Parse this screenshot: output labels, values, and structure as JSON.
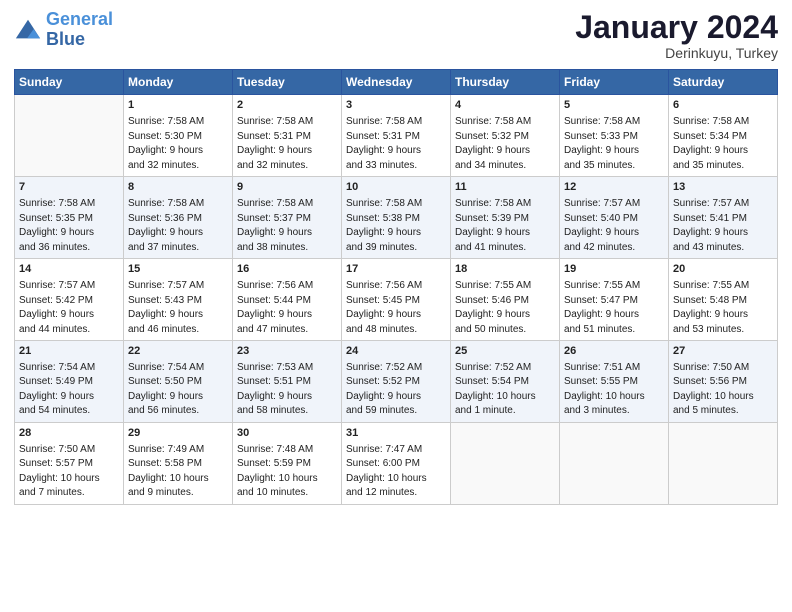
{
  "logo": {
    "line1": "General",
    "line2": "Blue"
  },
  "title": "January 2024",
  "subtitle": "Derinkuyu, Turkey",
  "days_of_week": [
    "Sunday",
    "Monday",
    "Tuesday",
    "Wednesday",
    "Thursday",
    "Friday",
    "Saturday"
  ],
  "weeks": [
    [
      {
        "day": "",
        "content": ""
      },
      {
        "day": "1",
        "content": "Sunrise: 7:58 AM\nSunset: 5:30 PM\nDaylight: 9 hours\nand 32 minutes."
      },
      {
        "day": "2",
        "content": "Sunrise: 7:58 AM\nSunset: 5:31 PM\nDaylight: 9 hours\nand 32 minutes."
      },
      {
        "day": "3",
        "content": "Sunrise: 7:58 AM\nSunset: 5:31 PM\nDaylight: 9 hours\nand 33 minutes."
      },
      {
        "day": "4",
        "content": "Sunrise: 7:58 AM\nSunset: 5:32 PM\nDaylight: 9 hours\nand 34 minutes."
      },
      {
        "day": "5",
        "content": "Sunrise: 7:58 AM\nSunset: 5:33 PM\nDaylight: 9 hours\nand 35 minutes."
      },
      {
        "day": "6",
        "content": "Sunrise: 7:58 AM\nSunset: 5:34 PM\nDaylight: 9 hours\nand 35 minutes."
      }
    ],
    [
      {
        "day": "7",
        "content": "Sunrise: 7:58 AM\nSunset: 5:35 PM\nDaylight: 9 hours\nand 36 minutes."
      },
      {
        "day": "8",
        "content": "Sunrise: 7:58 AM\nSunset: 5:36 PM\nDaylight: 9 hours\nand 37 minutes."
      },
      {
        "day": "9",
        "content": "Sunrise: 7:58 AM\nSunset: 5:37 PM\nDaylight: 9 hours\nand 38 minutes."
      },
      {
        "day": "10",
        "content": "Sunrise: 7:58 AM\nSunset: 5:38 PM\nDaylight: 9 hours\nand 39 minutes."
      },
      {
        "day": "11",
        "content": "Sunrise: 7:58 AM\nSunset: 5:39 PM\nDaylight: 9 hours\nand 41 minutes."
      },
      {
        "day": "12",
        "content": "Sunrise: 7:57 AM\nSunset: 5:40 PM\nDaylight: 9 hours\nand 42 minutes."
      },
      {
        "day": "13",
        "content": "Sunrise: 7:57 AM\nSunset: 5:41 PM\nDaylight: 9 hours\nand 43 minutes."
      }
    ],
    [
      {
        "day": "14",
        "content": "Sunrise: 7:57 AM\nSunset: 5:42 PM\nDaylight: 9 hours\nand 44 minutes."
      },
      {
        "day": "15",
        "content": "Sunrise: 7:57 AM\nSunset: 5:43 PM\nDaylight: 9 hours\nand 46 minutes."
      },
      {
        "day": "16",
        "content": "Sunrise: 7:56 AM\nSunset: 5:44 PM\nDaylight: 9 hours\nand 47 minutes."
      },
      {
        "day": "17",
        "content": "Sunrise: 7:56 AM\nSunset: 5:45 PM\nDaylight: 9 hours\nand 48 minutes."
      },
      {
        "day": "18",
        "content": "Sunrise: 7:55 AM\nSunset: 5:46 PM\nDaylight: 9 hours\nand 50 minutes."
      },
      {
        "day": "19",
        "content": "Sunrise: 7:55 AM\nSunset: 5:47 PM\nDaylight: 9 hours\nand 51 minutes."
      },
      {
        "day": "20",
        "content": "Sunrise: 7:55 AM\nSunset: 5:48 PM\nDaylight: 9 hours\nand 53 minutes."
      }
    ],
    [
      {
        "day": "21",
        "content": "Sunrise: 7:54 AM\nSunset: 5:49 PM\nDaylight: 9 hours\nand 54 minutes."
      },
      {
        "day": "22",
        "content": "Sunrise: 7:54 AM\nSunset: 5:50 PM\nDaylight: 9 hours\nand 56 minutes."
      },
      {
        "day": "23",
        "content": "Sunrise: 7:53 AM\nSunset: 5:51 PM\nDaylight: 9 hours\nand 58 minutes."
      },
      {
        "day": "24",
        "content": "Sunrise: 7:52 AM\nSunset: 5:52 PM\nDaylight: 9 hours\nand 59 minutes."
      },
      {
        "day": "25",
        "content": "Sunrise: 7:52 AM\nSunset: 5:54 PM\nDaylight: 10 hours\nand 1 minute."
      },
      {
        "day": "26",
        "content": "Sunrise: 7:51 AM\nSunset: 5:55 PM\nDaylight: 10 hours\nand 3 minutes."
      },
      {
        "day": "27",
        "content": "Sunrise: 7:50 AM\nSunset: 5:56 PM\nDaylight: 10 hours\nand 5 minutes."
      }
    ],
    [
      {
        "day": "28",
        "content": "Sunrise: 7:50 AM\nSunset: 5:57 PM\nDaylight: 10 hours\nand 7 minutes."
      },
      {
        "day": "29",
        "content": "Sunrise: 7:49 AM\nSunset: 5:58 PM\nDaylight: 10 hours\nand 9 minutes."
      },
      {
        "day": "30",
        "content": "Sunrise: 7:48 AM\nSunset: 5:59 PM\nDaylight: 10 hours\nand 10 minutes."
      },
      {
        "day": "31",
        "content": "Sunrise: 7:47 AM\nSunset: 6:00 PM\nDaylight: 10 hours\nand 12 minutes."
      },
      {
        "day": "",
        "content": ""
      },
      {
        "day": "",
        "content": ""
      },
      {
        "day": "",
        "content": ""
      }
    ]
  ]
}
